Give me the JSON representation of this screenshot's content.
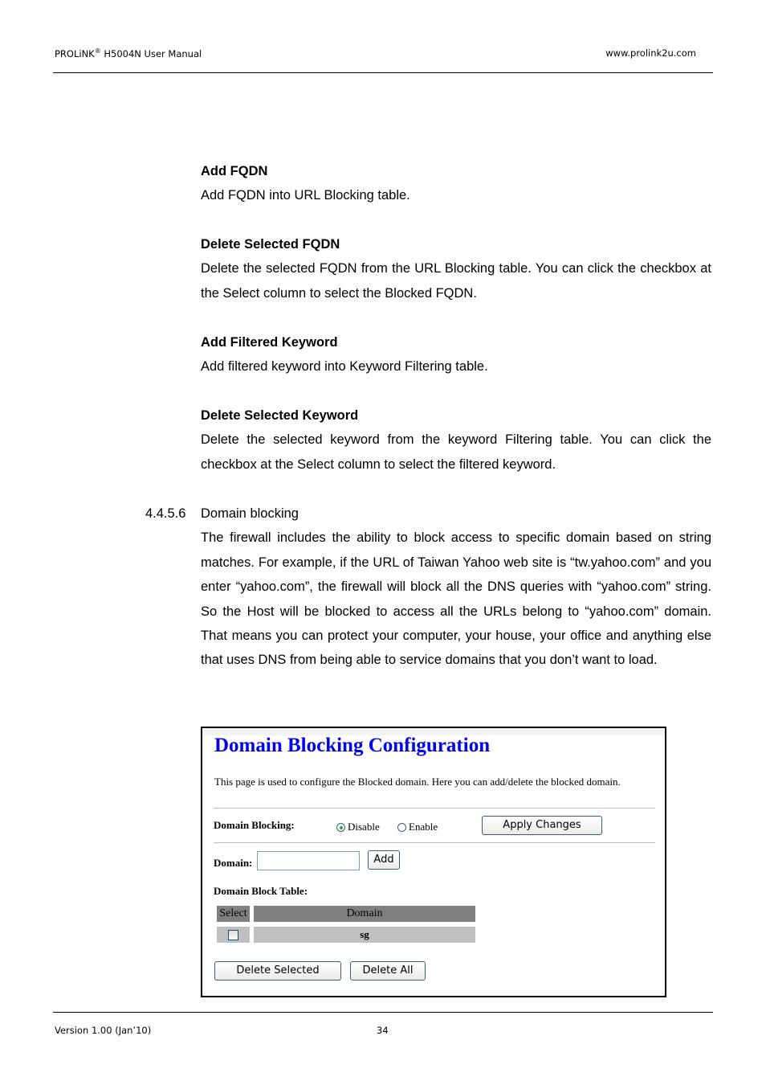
{
  "header": {
    "brand": "PROLiNK",
    "brand_mark": "®",
    "title_rest": " H5004N User Manual",
    "website": "www.prolink2u.com"
  },
  "sections": [
    {
      "heading": "Add FQDN",
      "text": "Add FQDN into URL Blocking table."
    },
    {
      "heading": "Delete Selected FQDN",
      "text": "Delete the selected FQDN from the URL Blocking table. You can click the checkbox at the Select column to select the Blocked FQDN."
    },
    {
      "heading": "Add Filtered Keyword",
      "text": "Add filtered keyword into Keyword Filtering table."
    },
    {
      "heading": "Delete Selected Keyword",
      "text": "Delete the selected keyword from the keyword Filtering table. You can click the checkbox at the Select column to select the filtered keyword."
    }
  ],
  "subsection": {
    "number": "4.4.5.6",
    "title": "Domain blocking",
    "text": "The firewall includes the ability to block access to specific domain based on string matches. For example, if the URL of Taiwan Yahoo web site is “tw.yahoo.com” and you enter “yahoo.com”, the firewall will block all the DNS queries with “yahoo.com” string. So the Host will be blocked to access all the URLs belong to “yahoo.com” domain. That means you can protect your computer, your house, your office and anything else that uses DNS from being able to service domains that you don’t want to load."
  },
  "screenshot": {
    "title": "Domain Blocking Configuration",
    "description": "This page is used to configure the Blocked domain. Here you can add/delete the blocked domain.",
    "blocking_label": "Domain Blocking:",
    "radio_options": [
      {
        "label": "Disable",
        "selected": true
      },
      {
        "label": "Enable",
        "selected": false
      }
    ],
    "apply_button": "Apply Changes",
    "domain_label": "Domain:",
    "domain_value": "",
    "add_button": "Add",
    "table_label": "Domain Block Table:",
    "table": {
      "headers": [
        "Select",
        "Domain"
      ],
      "rows": [
        {
          "checked": false,
          "domain": "sg"
        }
      ]
    },
    "delete_selected_button": "Delete Selected",
    "delete_all_button": "Delete All",
    "colors": {
      "title": "#0000ee",
      "table_header": "#808080",
      "table_row": "#c0c0c0",
      "radio_dot": "#23b323"
    }
  },
  "footer": {
    "version": "Version 1.00 (Jan’10)",
    "page_number": "34"
  }
}
